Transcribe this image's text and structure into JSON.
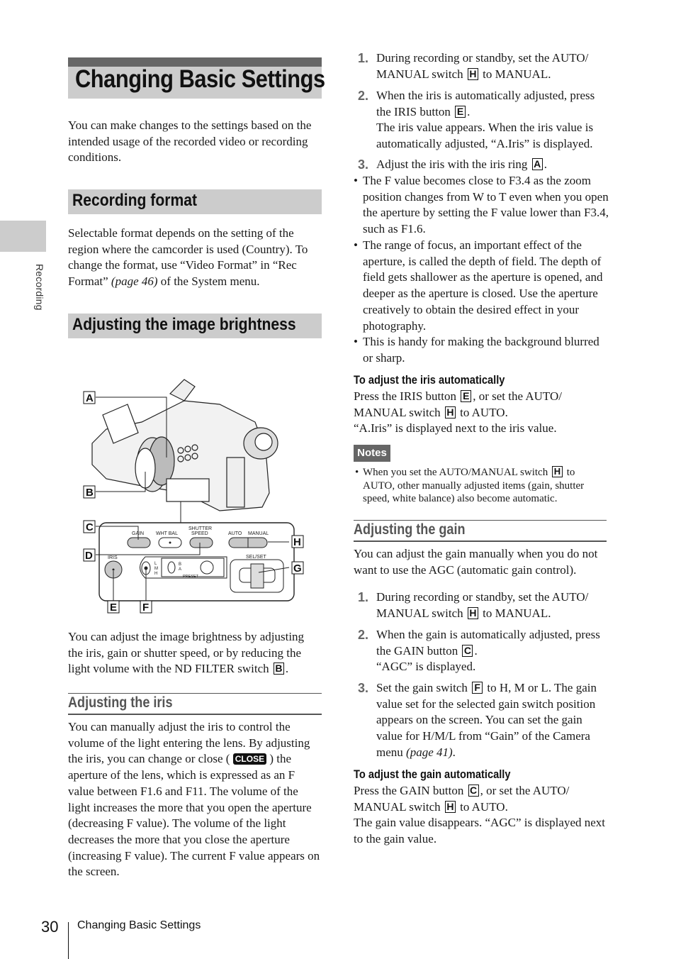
{
  "side_tab": {
    "label": "Recording"
  },
  "title": "Changing Basic Settings",
  "intro": "You can make changes to the settings based on the intended usage of the recorded video or recording conditions.",
  "recording_format": {
    "heading": "Recording format",
    "text_1": "Selectable format depends on the setting of the region where the camcorder is used (Country). To change the format, use “Video Format” in “Rec Format” ",
    "page_ref": "(page 46)",
    "text_2": " of the System menu."
  },
  "brightness": {
    "heading": "Adjusting the image brightness",
    "diagram": {
      "callouts": [
        "A",
        "B",
        "C",
        "D",
        "E",
        "F",
        "G",
        "H"
      ],
      "panel_labels": {
        "gain": "GAIN",
        "wht_bal": "WHT  BAL",
        "shutter_speed_1": "SHUTTER",
        "shutter_speed_2": "SPEED",
        "auto": "AUTO",
        "manual": "MANUAL",
        "iris": "IRIS",
        "sel_set": "SEL/SET",
        "l": "L",
        "m": "M",
        "h": "H",
        "b": "B",
        "a": "A",
        "preset": "PRESET"
      }
    },
    "text_1": "You can adjust the image brightness by adjusting the iris, gain or shutter speed, or by reducing the light volume with the ND FILTER switch ",
    "key_b": "B",
    "text_2": "."
  },
  "iris": {
    "heading": "Adjusting the iris",
    "text_1": "You can manually adjust the iris to control the volume of the light entering the lens. By adjusting the iris, you can change or close (",
    "close_badge": "CLOSE",
    "text_2": ") the aperture of the lens, which is expressed as an F value between F1.6 and F11. The volume of the light increases the more that you open the aperture (decreasing F value). The volume of the light decreases the more that you close the aperture (increasing F value). The current F value appears on the screen.",
    "steps": [
      {
        "num": "1.",
        "pre": "During recording or standby, set the AUTO/ MANUAL switch ",
        "key": "H",
        "post": " to MANUAL."
      },
      {
        "num": "2.",
        "pre": "When the iris is automatically adjusted, press the IRIS button ",
        "key": "E",
        "post": ".",
        "extra": "The iris value appears. When the iris value is automatically adjusted, “A.Iris” is displayed."
      },
      {
        "num": "3.",
        "pre": "Adjust the iris with the iris ring ",
        "key": "A",
        "post": "."
      }
    ],
    "bullets": [
      "The F value becomes close to F3.4 as the zoom position changes from W to T even when you open the aperture by setting the F value lower than F3.4, such as F1.6.",
      "The range of focus, an important effect of the aperture, is called the depth of field. The depth of field gets shallower as the aperture is opened, and deeper as the aperture is closed. Use the aperture creatively to obtain the desired effect in your photography.",
      "This is handy for making the background blurred or sharp."
    ],
    "auto": {
      "heading": "To adjust the iris automatically",
      "pre": "Press the IRIS button ",
      "key_1": "E",
      "mid": ", or set the AUTO/ MANUAL switch ",
      "key_2": "H",
      "post": " to AUTO.",
      "line_2": "“A.Iris” is displayed next to the iris value."
    }
  },
  "notes": {
    "badge": "Notes",
    "pre": "When you set the AUTO/MANUAL switch ",
    "key": "H",
    "post": " to AUTO, other manually adjusted items (gain, shutter speed, white balance) also become automatic."
  },
  "gain": {
    "heading": "Adjusting the gain",
    "intro": "You can adjust the gain manually when you do not want to use the AGC (automatic gain control).",
    "steps": [
      {
        "num": "1.",
        "pre": "During recording or standby, set the AUTO/ MANUAL switch ",
        "key": "H",
        "post": " to MANUAL."
      },
      {
        "num": "2.",
        "pre": "When the gain is automatically adjusted, press the GAIN button ",
        "key": "C",
        "post": ".",
        "extra": "“AGC” is displayed."
      },
      {
        "num": "3.",
        "pre": "Set the gain switch ",
        "key": "F",
        "post": " to H, M or L. The gain value set for the selected gain switch position appears on the screen. You can set the gain value for H/M/L from “Gain” of the Camera menu ",
        "page_ref": "(page 41)",
        "post2": "."
      }
    ],
    "auto": {
      "heading": "To adjust the gain automatically",
      "pre": "Press the GAIN button ",
      "key_1": "C",
      "mid": ", or set the AUTO/ MANUAL switch ",
      "key_2": "H",
      "post": " to AUTO.",
      "line_2": "The gain value disappears. “AGC” is displayed next to the gain value."
    }
  },
  "footer": {
    "page_number": "30",
    "section": "Changing Basic Settings"
  }
}
